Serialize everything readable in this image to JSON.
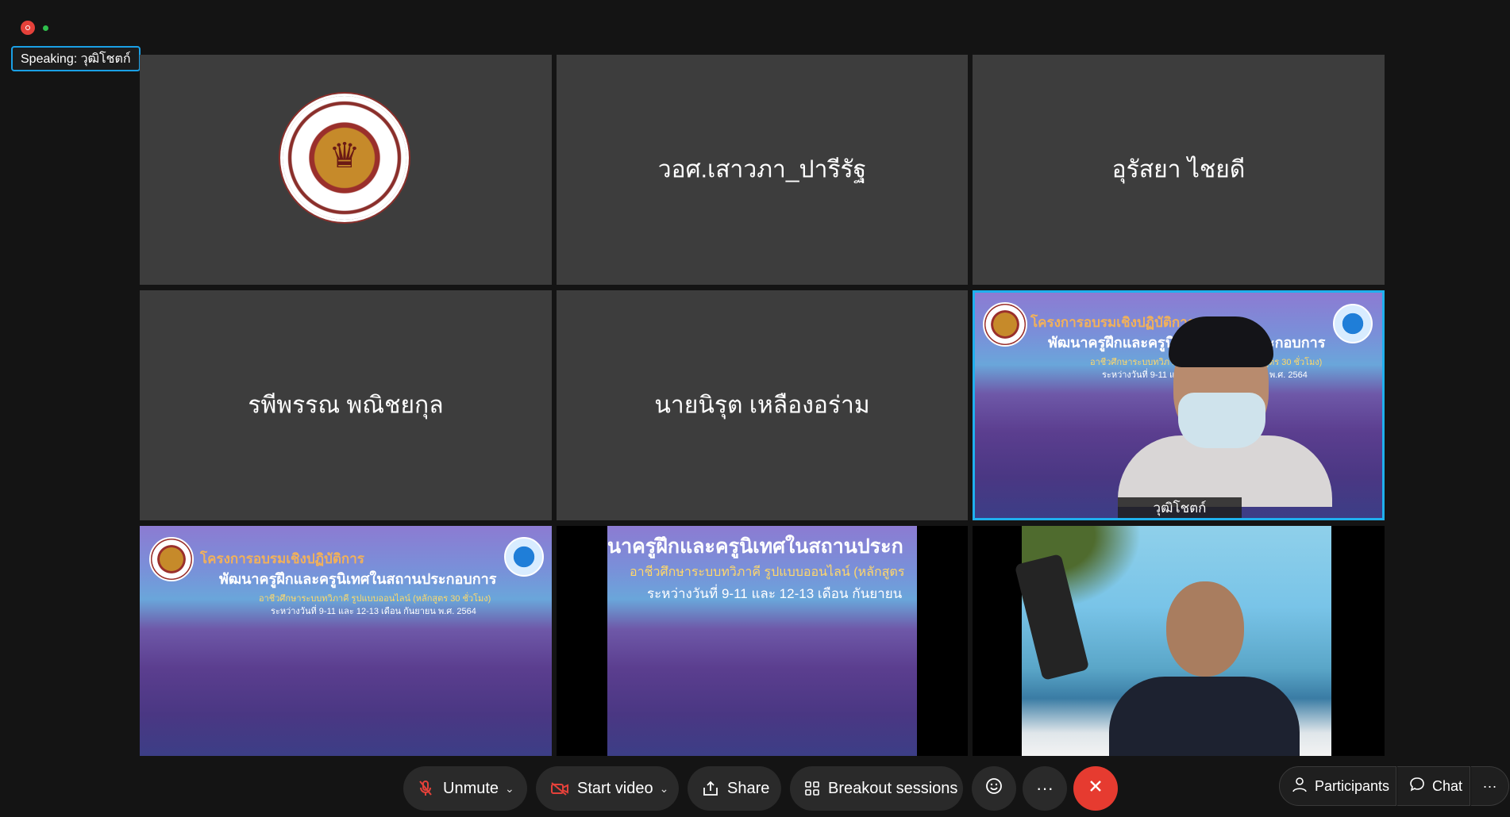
{
  "speaking_indicator": "Speaking: วุฒิโชตก์",
  "tiles": [
    {
      "name": ""
    },
    {
      "name": "วอศ.เสาวภา_ปารีรัฐ"
    },
    {
      "name": "อุรัสยา ไชยดี"
    },
    {
      "name": "รพีพรรณ พณิชยกุล"
    },
    {
      "name": "นายนิรุต เหลืองอร่าม"
    },
    {
      "name": "วุฒิโชตก์"
    }
  ],
  "slide": {
    "line1": "โครงการอบรมเชิงปฏิบัติการ",
    "line2": "พัฒนาครูฝึกและครูนิเทศในสถานประกอบการ",
    "line3": "อาชีวศึกษาระบบทวิภาคี รูปแบบออนไลน์ (หลักสูตร 30 ชั่วโมง)",
    "line4": "ระหว่างวันที่ 9-11 และ 12-13 เดือน กันยายน พ.ศ. 2564",
    "crop_line2": "นาครูฝึกและครูนิเทศในสถานประก",
    "crop_line3": "อาชีวศึกษาระบบทวิภาคี รูปแบบออนไลน์ (หลักสูตร",
    "crop_line4": "ระหว่างวันที่ 9-11 และ 12-13 เดือน กันยายน"
  },
  "toolbar": {
    "unmute": "Unmute",
    "start_video": "Start video",
    "share": "Share",
    "breakout": "Breakout sessions",
    "participants": "Participants",
    "chat": "Chat",
    "more": "···"
  },
  "colors": {
    "active_border": "#1fb0ee",
    "end_button": "#e63b30",
    "tile_bg": "#3d3d3d"
  }
}
